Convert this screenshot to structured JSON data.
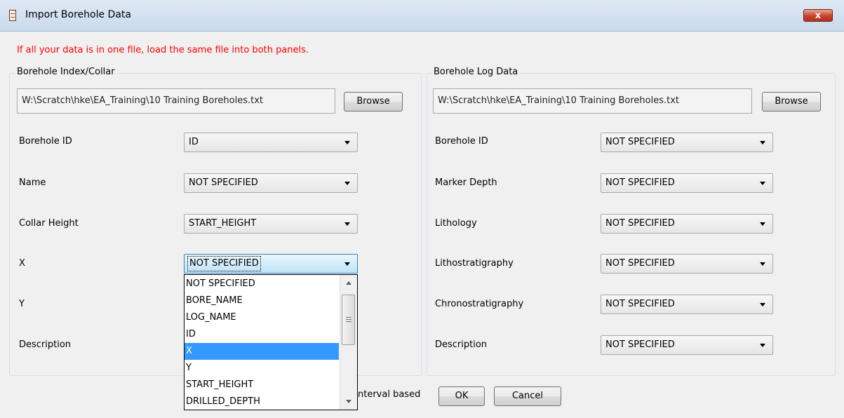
{
  "window": {
    "title": "Import Borehole Data",
    "close_label": "x"
  },
  "warning": "If all your data is in one file, load the same file into both panels.",
  "left_panel": {
    "legend": "Borehole Index/Collar",
    "file_path": "W:\\Scratch\\hke\\EA_Training\\10 Training Boreholes.txt",
    "browse_label": "Browse",
    "fields": [
      {
        "label": "Borehole ID",
        "value": "ID"
      },
      {
        "label": "Name",
        "value": "NOT SPECIFIED"
      },
      {
        "label": "Collar Height",
        "value": "START_HEIGHT"
      },
      {
        "label": "X",
        "value": "NOT SPECIFIED"
      },
      {
        "label": "Y",
        "value": ""
      },
      {
        "label": "Description",
        "value": ""
      }
    ]
  },
  "right_panel": {
    "legend": "Borehole Log Data",
    "file_path": "W:\\Scratch\\hke\\EA_Training\\10 Training Boreholes.txt",
    "browse_label": "Browse",
    "fields": [
      {
        "label": "Borehole ID",
        "value": "NOT SPECIFIED"
      },
      {
        "label": "Marker Depth",
        "value": "NOT SPECIFIED"
      },
      {
        "label": "Lithology",
        "value": "NOT SPECIFIED"
      },
      {
        "label": "Lithostratigraphy",
        "value": "NOT SPECIFIED"
      },
      {
        "label": "Chronostratigraphy",
        "value": "NOT SPECIFIED"
      },
      {
        "label": "Description",
        "value": "NOT SPECIFIED"
      }
    ]
  },
  "dropdown": {
    "options": [
      "NOT SPECIFIED",
      "BORE_NAME",
      "LOG_NAME",
      "ID",
      "X",
      "Y",
      "START_HEIGHT",
      "DRILLED_DEPTH"
    ],
    "selected_index": 4
  },
  "footer": {
    "interval_text": "nterval based",
    "ok_label": "OK",
    "cancel_label": "Cancel"
  }
}
